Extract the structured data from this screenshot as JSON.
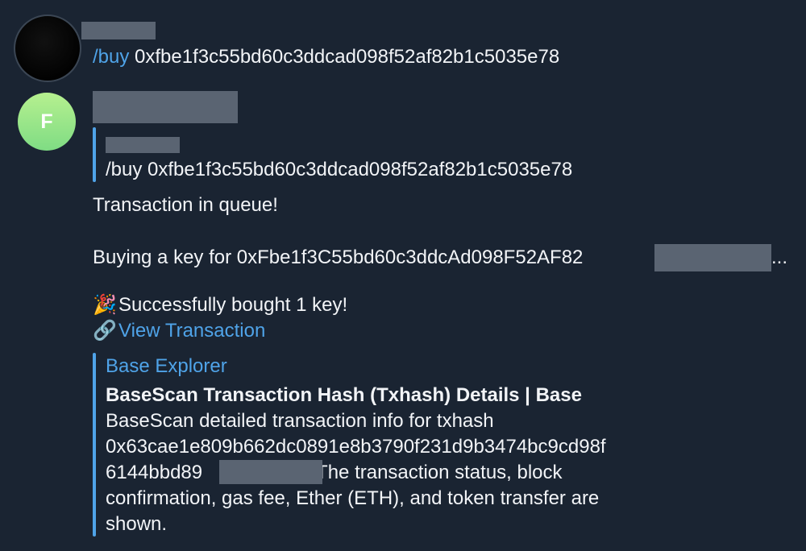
{
  "messages": [
    {
      "avatar_initial": "",
      "command": "/buy",
      "address": " 0xfbe1f3c55bd60c3ddcad098f52af82b1c5035e78"
    },
    {
      "avatar_initial": "F",
      "reply": {
        "text": "/buy 0xfbe1f3c55bd60c3ddcad098f52af82b1c5035e78"
      },
      "status_line": "Transaction in queue!",
      "buying_line": "Buying a key for 0xFbe1f3C55bd60c3ddcAd098F52AF82",
      "buying_suffix": "...",
      "success_emoji": "🎉",
      "success_text": "Successfully bought 1 key!",
      "link_emoji": "🔗",
      "link_text": "View Transaction",
      "preview": {
        "site": "Base Explorer",
        "title": "BaseScan Transaction Hash (Txhash) Details | Base",
        "desc_line1": "BaseScan detailed transaction info for txhash",
        "desc_line2": "0x63cae1e809b662dc0891e8b3790f231d9b3474bc9cd98f",
        "desc_line3a": "6144bbd89",
        "desc_line3b": ". The transaction status, block",
        "desc_line4": "confirmation, gas fee, Ether (ETH), and token transfer are",
        "desc_line5": "shown."
      }
    }
  ],
  "colors": {
    "background": "#1a2432",
    "accent": "#4fa3e8",
    "text": "#f2f4f7",
    "redaction": "#5a6472"
  }
}
